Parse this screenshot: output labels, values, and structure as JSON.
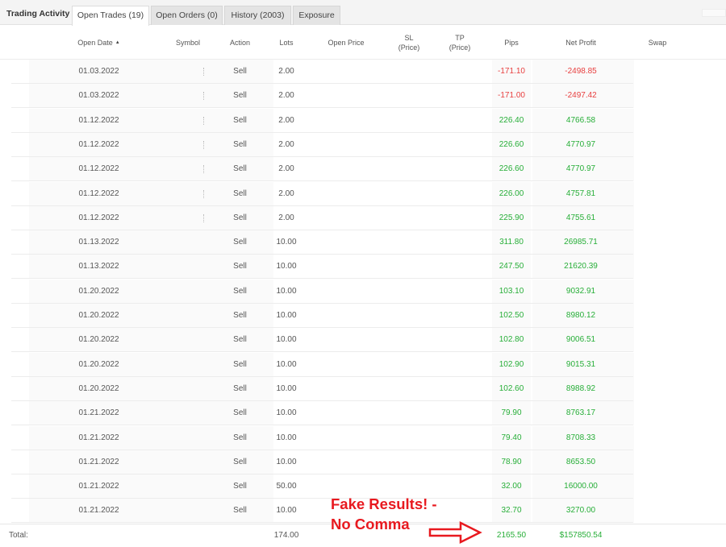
{
  "tabs": {
    "title": "Trading Activity",
    "items": [
      "Open Trades (19)",
      "Open Orders (0)",
      "History (2003)",
      "Exposure"
    ],
    "active": 0
  },
  "columns": {
    "open_date": "Open Date",
    "symbol": "Symbol",
    "action": "Action",
    "lots": "Lots",
    "open_price": "Open Price",
    "sl_top": "SL",
    "sl_bottom": "(Price)",
    "tp_top": "TP",
    "tp_bottom": "(Price)",
    "pips": "Pips",
    "net_profit": "Net Profit",
    "swap": "Swap"
  },
  "rows": [
    {
      "date": "01.03.2022",
      "action": "Sell",
      "lots": "2.00",
      "pips": "-171.10",
      "profit": "-2498.85",
      "status": "loss"
    },
    {
      "date": "01.03.2022",
      "action": "Sell",
      "lots": "2.00",
      "pips": "-171.00",
      "profit": "-2497.42",
      "status": "loss"
    },
    {
      "date": "01.12.2022",
      "action": "Sell",
      "lots": "2.00",
      "pips": "226.40",
      "profit": "4766.58",
      "status": "gain"
    },
    {
      "date": "01.12.2022",
      "action": "Sell",
      "lots": "2.00",
      "pips": "226.60",
      "profit": "4770.97",
      "status": "gain"
    },
    {
      "date": "01.12.2022",
      "action": "Sell",
      "lots": "2.00",
      "pips": "226.60",
      "profit": "4770.97",
      "status": "gain"
    },
    {
      "date": "01.12.2022",
      "action": "Sell",
      "lots": "2.00",
      "pips": "226.00",
      "profit": "4757.81",
      "status": "gain"
    },
    {
      "date": "01.12.2022",
      "action": "Sell",
      "lots": "2.00",
      "pips": "225.90",
      "profit": "4755.61",
      "status": "gain"
    },
    {
      "date": "01.13.2022",
      "action": "Sell",
      "lots": "10.00",
      "pips": "311.80",
      "profit": "26985.71",
      "status": "gain"
    },
    {
      "date": "01.13.2022",
      "action": "Sell",
      "lots": "10.00",
      "pips": "247.50",
      "profit": "21620.39",
      "status": "gain"
    },
    {
      "date": "01.20.2022",
      "action": "Sell",
      "lots": "10.00",
      "pips": "103.10",
      "profit": "9032.91",
      "status": "gain"
    },
    {
      "date": "01.20.2022",
      "action": "Sell",
      "lots": "10.00",
      "pips": "102.50",
      "profit": "8980.12",
      "status": "gain"
    },
    {
      "date": "01.20.2022",
      "action": "Sell",
      "lots": "10.00",
      "pips": "102.80",
      "profit": "9006.51",
      "status": "gain"
    },
    {
      "date": "01.20.2022",
      "action": "Sell",
      "lots": "10.00",
      "pips": "102.90",
      "profit": "9015.31",
      "status": "gain"
    },
    {
      "date": "01.20.2022",
      "action": "Sell",
      "lots": "10.00",
      "pips": "102.60",
      "profit": "8988.92",
      "status": "gain"
    },
    {
      "date": "01.21.2022",
      "action": "Sell",
      "lots": "10.00",
      "pips": "79.90",
      "profit": "8763.17",
      "status": "gain"
    },
    {
      "date": "01.21.2022",
      "action": "Sell",
      "lots": "10.00",
      "pips": "79.40",
      "profit": "8708.33",
      "status": "gain"
    },
    {
      "date": "01.21.2022",
      "action": "Sell",
      "lots": "10.00",
      "pips": "78.90",
      "profit": "8653.50",
      "status": "gain"
    },
    {
      "date": "01.21.2022",
      "action": "Sell",
      "lots": "50.00",
      "pips": "32.00",
      "profit": "16000.00",
      "status": "gain"
    },
    {
      "date": "01.21.2022",
      "action": "Sell",
      "lots": "10.00",
      "pips": "32.70",
      "profit": "3270.00",
      "status": "gain"
    }
  ],
  "totals": {
    "label": "Total:",
    "lots": "174.00",
    "pips": "2165.50",
    "profit": "$157850.54"
  },
  "annotation": {
    "line1": "Fake Results! -",
    "line2": "No Comma"
  },
  "icons": {
    "sort": "sort-ascending-icon",
    "arrow": "right-arrow-icon"
  },
  "colors": {
    "gain": "#27ae38",
    "loss": "#e84040",
    "annotation": "#e8191f"
  }
}
